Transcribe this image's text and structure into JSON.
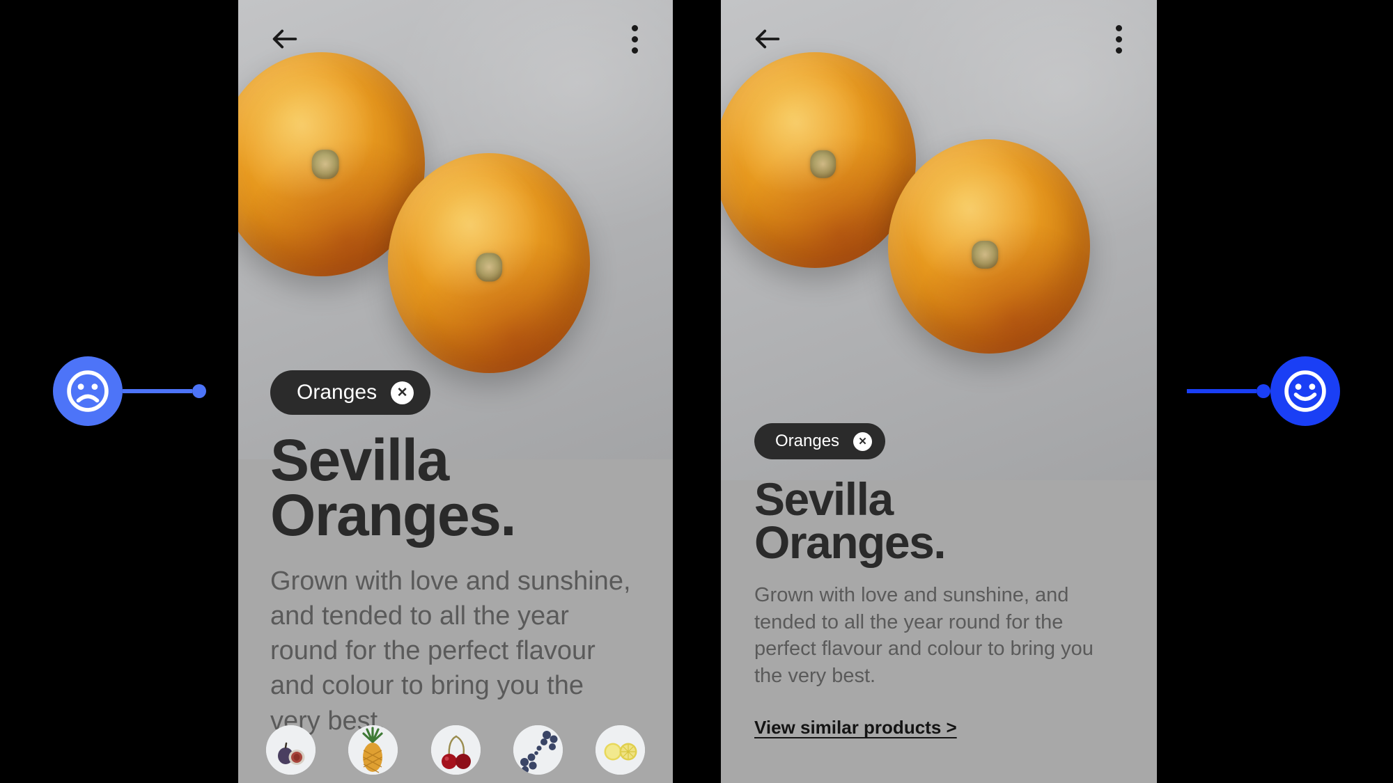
{
  "background_color": "#000000",
  "markers": {
    "left": {
      "icon": "sad-face-icon",
      "color": "#4d74f8",
      "sentiment": "negative"
    },
    "right": {
      "icon": "happy-face-icon",
      "color": "#1a3ff5",
      "sentiment": "positive"
    }
  },
  "panels": [
    {
      "id": "variant-a",
      "background_color": "#a8a8a8",
      "header": {
        "back_icon": "back-arrow-icon",
        "menu_icon": "kebab-menu-icon"
      },
      "chip": {
        "label": "Oranges",
        "close_label": "✕"
      },
      "headline_line1": "Sevilla",
      "headline_line2": "Oranges.",
      "body": "Grown with love and sunshine, and tended to all the year round for the perfect flavour and colour to bring you the very best.",
      "thumbnails": [
        {
          "name": "figs-thumbnail",
          "label": "Figs"
        },
        {
          "name": "pineapple-thumbnail",
          "label": "Pineapple"
        },
        {
          "name": "cherries-thumbnail",
          "label": "Cherries"
        },
        {
          "name": "blueberries-thumbnail",
          "label": "Blueberries"
        },
        {
          "name": "lemon-thumbnail",
          "label": "Lemon"
        }
      ]
    },
    {
      "id": "variant-b",
      "background_color": "#a8a8a8",
      "header": {
        "back_icon": "back-arrow-icon",
        "menu_icon": "kebab-menu-icon"
      },
      "chip": {
        "label": "Oranges",
        "close_label": "✕"
      },
      "headline_line1": "Sevilla",
      "headline_line2": "Oranges.",
      "body": "Grown with love and sunshine, and tended to all the year round for the perfect flavour and colour to bring you the very best.",
      "similar_link": "View similar products >"
    }
  ]
}
